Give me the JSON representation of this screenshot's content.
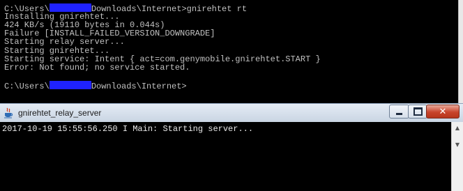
{
  "console": {
    "lines": [
      {
        "pre": "C:\\Users\\",
        "redacted": true,
        "post": "Downloads\\Internet>gnirehtet rt"
      },
      {
        "text": "Installing gnirehtet..."
      },
      {
        "text": "424 KB/s (19110 bytes in 0.044s)"
      },
      {
        "text": "Failure [INSTALL_FAILED_VERSION_DOWNGRADE]"
      },
      {
        "text": "Starting relay server..."
      },
      {
        "text": "Starting gnirehtet..."
      },
      {
        "text": "Starting service: Intent { act=com.genymobile.gnirehtet.START }"
      },
      {
        "text": "Error: Not found; no service started."
      },
      {
        "text": ""
      },
      {
        "pre": "C:\\Users\\",
        "redacted": true,
        "post": "Downloads\\Internet>"
      }
    ],
    "redaction_color": "#1f22ff"
  },
  "relay_window": {
    "title": "gnirehtet_relay_server",
    "log_line": "2017-10-19 15:55:56.250 I Main: Starting server...",
    "icons": {
      "app": "java-cup-icon",
      "minimize": "minimize-icon",
      "maximize": "maximize-icon",
      "close": "close-icon"
    },
    "close_glyph": "✕",
    "scroll_up_glyph": "▲",
    "scroll_down_glyph": "▼"
  }
}
